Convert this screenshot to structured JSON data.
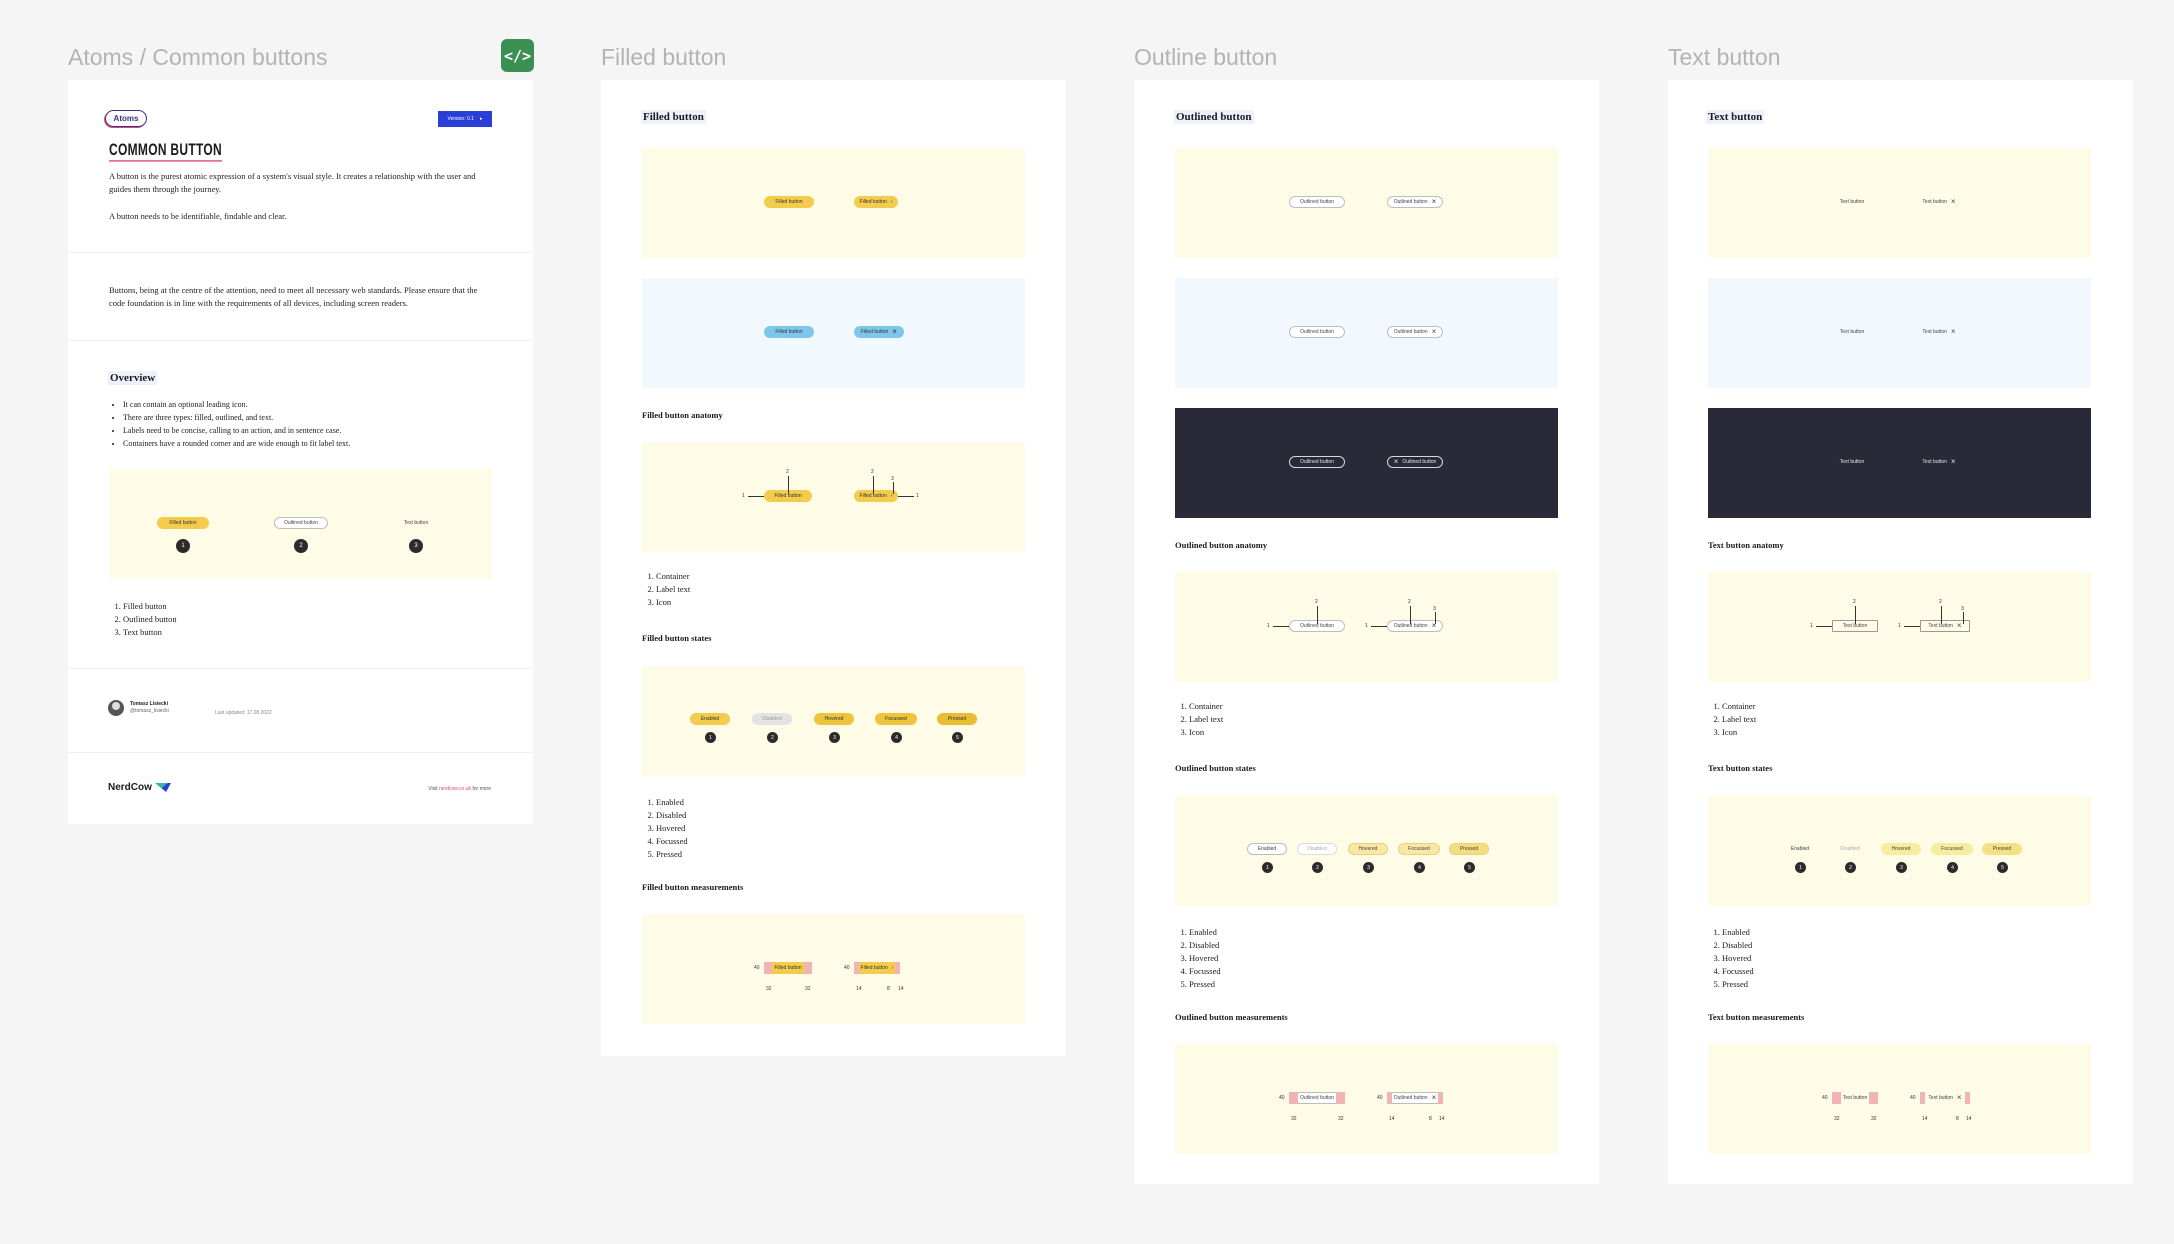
{
  "frames": [
    {
      "title": "Atoms / Common buttons"
    },
    {
      "title": "Filled button"
    },
    {
      "title": "Outline button"
    },
    {
      "title": "Text button"
    }
  ],
  "code_badge": "</>",
  "intro": {
    "logo": "Atoms",
    "version_button": "Version: 0.1",
    "title": "COMMON BUTTON",
    "para1": "A button is the purest atomic expression of a system's visual style. It creates a relationship with the user and guides them through the journey.",
    "para2": "A button needs to be identifiable, findable and clear.",
    "para3": "Buttons, being at the centre of the attention, need to meet all necessary web standards. Please ensure that the code foundation is in line with the requirements of all devices, including screen readers.",
    "overview_heading": "Overview",
    "bullets": [
      "It can contain an optional leading icon.",
      "There are three types: filled, outlined, and text.",
      "Labels need to be concise, calling to an action, and in sentence case.",
      "Containers have a rounded corner and are wide enough to fit label text."
    ],
    "types": [
      "Filled button",
      "Outlined button",
      "Text button"
    ],
    "type_numbers": [
      "1",
      "2",
      "3"
    ],
    "author_name": "Tomasz Lisiecki",
    "author_handle": "@tomasz_lisiecki",
    "last_updated": "Last updated: 17.08.2022",
    "brand": "NerdCow",
    "footer_pre": "Visit",
    "footer_link": "nerdcow.co.uk",
    "footer_post": "for more"
  },
  "filled": {
    "heading": "Filled button",
    "label": "Filled button",
    "anatomy_heading": "Filled button anatomy",
    "anatomy_list": [
      "Container",
      "Label text",
      "Icon"
    ],
    "states_heading": "Filled button states",
    "states": [
      "Enabled",
      "Disabled",
      "Hovered",
      "Focussed",
      "Pressed"
    ],
    "measurements_heading": "Filled button measurements"
  },
  "outline": {
    "heading": "Outlined button",
    "label": "Outlined button",
    "anatomy_heading": "Outlined button anatomy",
    "anatomy_list": [
      "Container",
      "Label text",
      "Icon"
    ],
    "states_heading": "Outlined button states",
    "states": [
      "Enabled",
      "Disabled",
      "Hovered",
      "Focussed",
      "Pressed"
    ],
    "measurements_heading": "Outlined button measurements"
  },
  "text": {
    "heading": "Text button",
    "label": "Text button",
    "anatomy_heading": "Text button anatomy",
    "anatomy_list": [
      "Container",
      "Label text",
      "Icon"
    ],
    "states_heading": "Text button states",
    "states": [
      "Enabled",
      "Disabled",
      "Hovered",
      "Focussed",
      "Pressed"
    ],
    "measurements_heading": "Text button measurements"
  },
  "state_numbers": [
    "1",
    "2",
    "3",
    "4",
    "5"
  ],
  "anatomy_marks": {
    "container": "1",
    "label": "2",
    "icon": "3"
  },
  "measure": {
    "height": "40",
    "pad_left": "32",
    "pad_right": "32",
    "icon_pad_left": "14",
    "gap": "8",
    "icon_pad_right": "14"
  },
  "colors": {
    "filled": "#f3cc4e",
    "filled_blue": "#7ec6ea",
    "panel_yellow": "#fefbe6",
    "panel_blue": "#f1f8fe",
    "panel_dark": "#2a2938",
    "accent_blue": "#2a3fd8",
    "badge_green": "#3c8f52"
  }
}
